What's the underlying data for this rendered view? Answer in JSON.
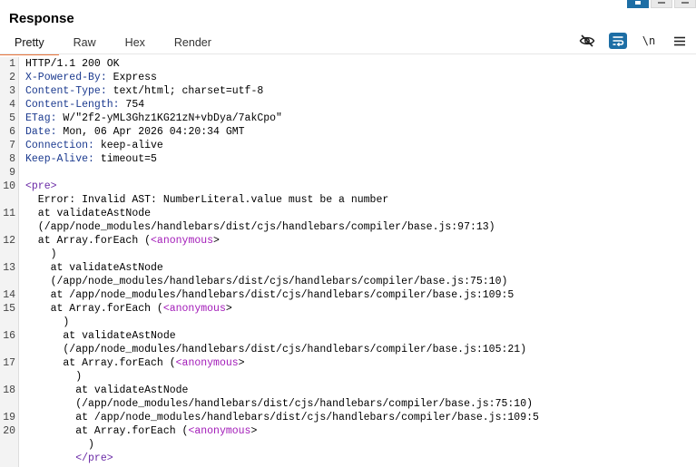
{
  "panel": {
    "title": "Response"
  },
  "tabs": [
    {
      "label": "Pretty",
      "active": true
    },
    {
      "label": "Raw",
      "active": false
    },
    {
      "label": "Hex",
      "active": false
    },
    {
      "label": "Render",
      "active": false
    }
  ],
  "toolbar": {
    "hide_icon": "eye-slash-icon",
    "wrap_icon": "text-wrap-icon",
    "newline_label": "\\n",
    "menu_icon": "hamburger-menu-icon"
  },
  "colors": {
    "accent": "#e8743b",
    "button_blue": "#1d6ea5",
    "header_key": "#1b3a8f",
    "tag": "#6a2aa6",
    "anonymous": "#a21ab8"
  },
  "lines": [
    {
      "num": "1",
      "parts": [
        {
          "t": "HTTP/1.1 200 OK",
          "c": ""
        }
      ]
    },
    {
      "num": "2",
      "parts": [
        {
          "t": "X-Powered-By:",
          "c": "hk"
        },
        {
          "t": " Express",
          "c": ""
        }
      ]
    },
    {
      "num": "3",
      "parts": [
        {
          "t": "Content-Type:",
          "c": "hk"
        },
        {
          "t": " text/html; charset=utf-8",
          "c": ""
        }
      ]
    },
    {
      "num": "4",
      "parts": [
        {
          "t": "Content-Length:",
          "c": "hk"
        },
        {
          "t": " 754",
          "c": ""
        }
      ]
    },
    {
      "num": "5",
      "parts": [
        {
          "t": "ETag:",
          "c": "hk"
        },
        {
          "t": " W/\"2f2-yML3Ghz1KG21zN+vbDya/7akCpo\"",
          "c": ""
        }
      ]
    },
    {
      "num": "6",
      "parts": [
        {
          "t": "Date:",
          "c": "hk"
        },
        {
          "t": " Mon, 06 Apr 2026 04:20:34 GMT",
          "c": ""
        }
      ]
    },
    {
      "num": "7",
      "parts": [
        {
          "t": "Connection:",
          "c": "hk"
        },
        {
          "t": " keep-alive",
          "c": ""
        }
      ]
    },
    {
      "num": "8",
      "parts": [
        {
          "t": "Keep-Alive:",
          "c": "hk"
        },
        {
          "t": " timeout=5",
          "c": ""
        }
      ]
    },
    {
      "num": "9",
      "parts": []
    },
    {
      "num": "10",
      "parts": [
        {
          "t": "<pre>",
          "c": "tag"
        }
      ]
    },
    {
      "num": "",
      "parts": [
        {
          "t": "  Error: Invalid AST: NumberLiteral.value must be a number",
          "c": ""
        }
      ]
    },
    {
      "num": "11",
      "parts": [
        {
          "t": "  at validateAstNode",
          "c": ""
        }
      ]
    },
    {
      "num": "",
      "parts": [
        {
          "t": "  (/app/node_modules/handlebars/dist/cjs/handlebars/compiler/base.js:97:13)",
          "c": ""
        }
      ]
    },
    {
      "num": "12",
      "parts": [
        {
          "t": "  at Array.forEach (",
          "c": ""
        },
        {
          "t": "<anonymous",
          "c": "anon"
        },
        {
          "t": ">",
          "c": ""
        }
      ]
    },
    {
      "num": "",
      "parts": [
        {
          "t": "    )",
          "c": ""
        }
      ]
    },
    {
      "num": "13",
      "parts": [
        {
          "t": "    at validateAstNode",
          "c": ""
        }
      ]
    },
    {
      "num": "",
      "parts": [
        {
          "t": "    (/app/node_modules/handlebars/dist/cjs/handlebars/compiler/base.js:75:10)",
          "c": ""
        }
      ]
    },
    {
      "num": "14",
      "parts": [
        {
          "t": "    at /app/node_modules/handlebars/dist/cjs/handlebars/compiler/base.js:109:5",
          "c": ""
        }
      ]
    },
    {
      "num": "15",
      "parts": [
        {
          "t": "    at Array.forEach (",
          "c": ""
        },
        {
          "t": "<anonymous",
          "c": "anon"
        },
        {
          "t": ">",
          "c": ""
        }
      ]
    },
    {
      "num": "",
      "parts": [
        {
          "t": "      )",
          "c": ""
        }
      ]
    },
    {
      "num": "16",
      "parts": [
        {
          "t": "      at validateAstNode",
          "c": ""
        }
      ]
    },
    {
      "num": "",
      "parts": [
        {
          "t": "      (/app/node_modules/handlebars/dist/cjs/handlebars/compiler/base.js:105:21)",
          "c": ""
        }
      ]
    },
    {
      "num": "17",
      "parts": [
        {
          "t": "      at Array.forEach (",
          "c": ""
        },
        {
          "t": "<anonymous",
          "c": "anon"
        },
        {
          "t": ">",
          "c": ""
        }
      ]
    },
    {
      "num": "",
      "parts": [
        {
          "t": "        )",
          "c": ""
        }
      ]
    },
    {
      "num": "18",
      "parts": [
        {
          "t": "        at validateAstNode",
          "c": ""
        }
      ]
    },
    {
      "num": "",
      "parts": [
        {
          "t": "        (/app/node_modules/handlebars/dist/cjs/handlebars/compiler/base.js:75:10)",
          "c": ""
        }
      ]
    },
    {
      "num": "19",
      "parts": [
        {
          "t": "        at /app/node_modules/handlebars/dist/cjs/handlebars/compiler/base.js:109:5",
          "c": ""
        }
      ]
    },
    {
      "num": "20",
      "parts": [
        {
          "t": "        at Array.forEach (",
          "c": ""
        },
        {
          "t": "<anonymous",
          "c": "anon"
        },
        {
          "t": ">",
          "c": ""
        }
      ]
    },
    {
      "num": "",
      "parts": [
        {
          "t": "          )",
          "c": ""
        }
      ]
    },
    {
      "num": "",
      "parts": [
        {
          "t": "        ",
          "c": ""
        },
        {
          "t": "</pre>",
          "c": "tag"
        }
      ]
    }
  ]
}
